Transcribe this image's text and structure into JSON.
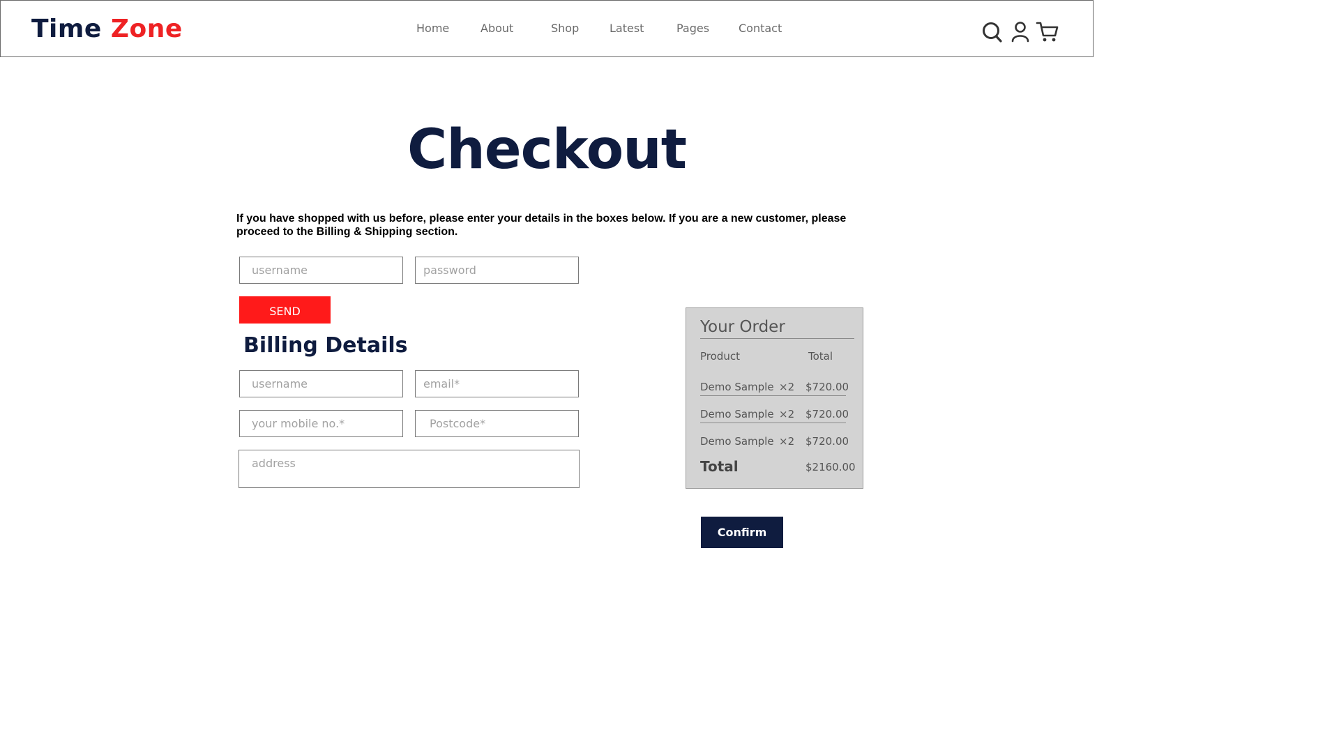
{
  "header": {
    "logo_part1": "Time",
    "logo_part2": "Zone",
    "nav": [
      "Home",
      "About",
      "Shop",
      "Latest",
      "Pages",
      "Contact"
    ],
    "icons": [
      "search-icon",
      "user-icon",
      "cart-icon"
    ]
  },
  "main": {
    "title": "Checkout",
    "intro": "If you have shopped with us before, please enter your details in the boxes below. If you are a new customer, please proceed to the Billing & Shipping section.",
    "login": {
      "username_placeholder": "username",
      "password_placeholder": "password",
      "send_label": "SEND"
    },
    "billing": {
      "title": "Billing Details",
      "username_placeholder": "username",
      "email_placeholder": "email*",
      "mobile_placeholder": "your mobile no.*",
      "postcode_placeholder": "Postcode*",
      "address_placeholder": "address"
    }
  },
  "order": {
    "title": "Your Order",
    "col_product": "Product",
    "col_total": "Total",
    "items": [
      {
        "name": "Demo Sample",
        "qty": "×2",
        "price": "$720.00"
      },
      {
        "name": "Demo Sample",
        "qty": "×2",
        "price": "$720.00"
      },
      {
        "name": "Demo Sample",
        "qty": "×2",
        "price": "$720.00"
      }
    ],
    "total_label": "Total",
    "total_value": "$2160.00",
    "confirm_label": "Confirm"
  },
  "colors": {
    "brand_dark": "#0f1c3f",
    "brand_red": "#ee2224",
    "send_red": "#ff1a1a",
    "order_bg": "#d3d3d3"
  }
}
